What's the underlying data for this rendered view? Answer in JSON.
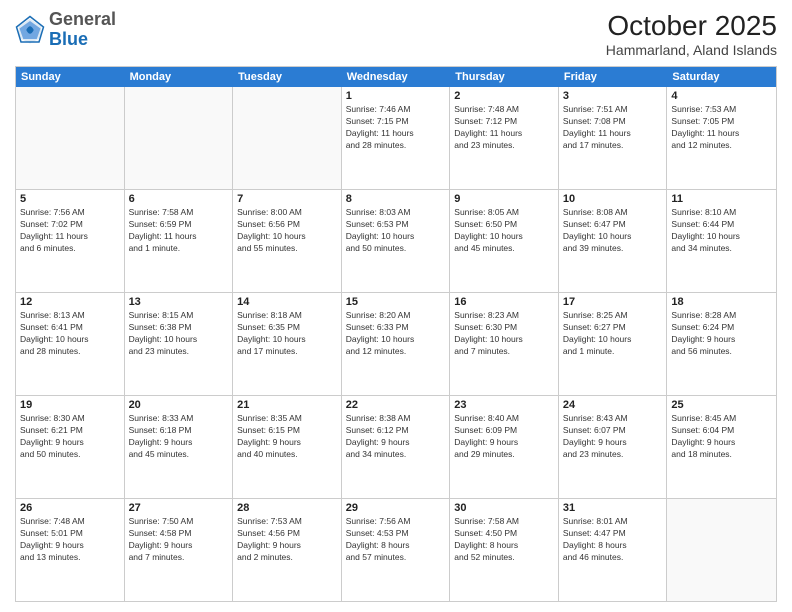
{
  "header": {
    "logo_general": "General",
    "logo_blue": "Blue",
    "month_title": "October 2025",
    "location": "Hammarland, Aland Islands"
  },
  "day_headers": [
    "Sunday",
    "Monday",
    "Tuesday",
    "Wednesday",
    "Thursday",
    "Friday",
    "Saturday"
  ],
  "weeks": [
    {
      "days": [
        {
          "number": "",
          "info": "",
          "empty": true
        },
        {
          "number": "",
          "info": "",
          "empty": true
        },
        {
          "number": "",
          "info": "",
          "empty": true
        },
        {
          "number": "1",
          "info": "Sunrise: 7:46 AM\nSunset: 7:15 PM\nDaylight: 11 hours\nand 28 minutes."
        },
        {
          "number": "2",
          "info": "Sunrise: 7:48 AM\nSunset: 7:12 PM\nDaylight: 11 hours\nand 23 minutes."
        },
        {
          "number": "3",
          "info": "Sunrise: 7:51 AM\nSunset: 7:08 PM\nDaylight: 11 hours\nand 17 minutes."
        },
        {
          "number": "4",
          "info": "Sunrise: 7:53 AM\nSunset: 7:05 PM\nDaylight: 11 hours\nand 12 minutes."
        }
      ]
    },
    {
      "days": [
        {
          "number": "5",
          "info": "Sunrise: 7:56 AM\nSunset: 7:02 PM\nDaylight: 11 hours\nand 6 minutes."
        },
        {
          "number": "6",
          "info": "Sunrise: 7:58 AM\nSunset: 6:59 PM\nDaylight: 11 hours\nand 1 minute."
        },
        {
          "number": "7",
          "info": "Sunrise: 8:00 AM\nSunset: 6:56 PM\nDaylight: 10 hours\nand 55 minutes."
        },
        {
          "number": "8",
          "info": "Sunrise: 8:03 AM\nSunset: 6:53 PM\nDaylight: 10 hours\nand 50 minutes."
        },
        {
          "number": "9",
          "info": "Sunrise: 8:05 AM\nSunset: 6:50 PM\nDaylight: 10 hours\nand 45 minutes."
        },
        {
          "number": "10",
          "info": "Sunrise: 8:08 AM\nSunset: 6:47 PM\nDaylight: 10 hours\nand 39 minutes."
        },
        {
          "number": "11",
          "info": "Sunrise: 8:10 AM\nSunset: 6:44 PM\nDaylight: 10 hours\nand 34 minutes."
        }
      ]
    },
    {
      "days": [
        {
          "number": "12",
          "info": "Sunrise: 8:13 AM\nSunset: 6:41 PM\nDaylight: 10 hours\nand 28 minutes."
        },
        {
          "number": "13",
          "info": "Sunrise: 8:15 AM\nSunset: 6:38 PM\nDaylight: 10 hours\nand 23 minutes."
        },
        {
          "number": "14",
          "info": "Sunrise: 8:18 AM\nSunset: 6:35 PM\nDaylight: 10 hours\nand 17 minutes."
        },
        {
          "number": "15",
          "info": "Sunrise: 8:20 AM\nSunset: 6:33 PM\nDaylight: 10 hours\nand 12 minutes."
        },
        {
          "number": "16",
          "info": "Sunrise: 8:23 AM\nSunset: 6:30 PM\nDaylight: 10 hours\nand 7 minutes."
        },
        {
          "number": "17",
          "info": "Sunrise: 8:25 AM\nSunset: 6:27 PM\nDaylight: 10 hours\nand 1 minute."
        },
        {
          "number": "18",
          "info": "Sunrise: 8:28 AM\nSunset: 6:24 PM\nDaylight: 9 hours\nand 56 minutes."
        }
      ]
    },
    {
      "days": [
        {
          "number": "19",
          "info": "Sunrise: 8:30 AM\nSunset: 6:21 PM\nDaylight: 9 hours\nand 50 minutes."
        },
        {
          "number": "20",
          "info": "Sunrise: 8:33 AM\nSunset: 6:18 PM\nDaylight: 9 hours\nand 45 minutes."
        },
        {
          "number": "21",
          "info": "Sunrise: 8:35 AM\nSunset: 6:15 PM\nDaylight: 9 hours\nand 40 minutes."
        },
        {
          "number": "22",
          "info": "Sunrise: 8:38 AM\nSunset: 6:12 PM\nDaylight: 9 hours\nand 34 minutes."
        },
        {
          "number": "23",
          "info": "Sunrise: 8:40 AM\nSunset: 6:09 PM\nDaylight: 9 hours\nand 29 minutes."
        },
        {
          "number": "24",
          "info": "Sunrise: 8:43 AM\nSunset: 6:07 PM\nDaylight: 9 hours\nand 23 minutes."
        },
        {
          "number": "25",
          "info": "Sunrise: 8:45 AM\nSunset: 6:04 PM\nDaylight: 9 hours\nand 18 minutes."
        }
      ]
    },
    {
      "days": [
        {
          "number": "26",
          "info": "Sunrise: 7:48 AM\nSunset: 5:01 PM\nDaylight: 9 hours\nand 13 minutes."
        },
        {
          "number": "27",
          "info": "Sunrise: 7:50 AM\nSunset: 4:58 PM\nDaylight: 9 hours\nand 7 minutes."
        },
        {
          "number": "28",
          "info": "Sunrise: 7:53 AM\nSunset: 4:56 PM\nDaylight: 9 hours\nand 2 minutes."
        },
        {
          "number": "29",
          "info": "Sunrise: 7:56 AM\nSunset: 4:53 PM\nDaylight: 8 hours\nand 57 minutes."
        },
        {
          "number": "30",
          "info": "Sunrise: 7:58 AM\nSunset: 4:50 PM\nDaylight: 8 hours\nand 52 minutes."
        },
        {
          "number": "31",
          "info": "Sunrise: 8:01 AM\nSunset: 4:47 PM\nDaylight: 8 hours\nand 46 minutes."
        },
        {
          "number": "",
          "info": "",
          "empty": true
        }
      ]
    }
  ]
}
